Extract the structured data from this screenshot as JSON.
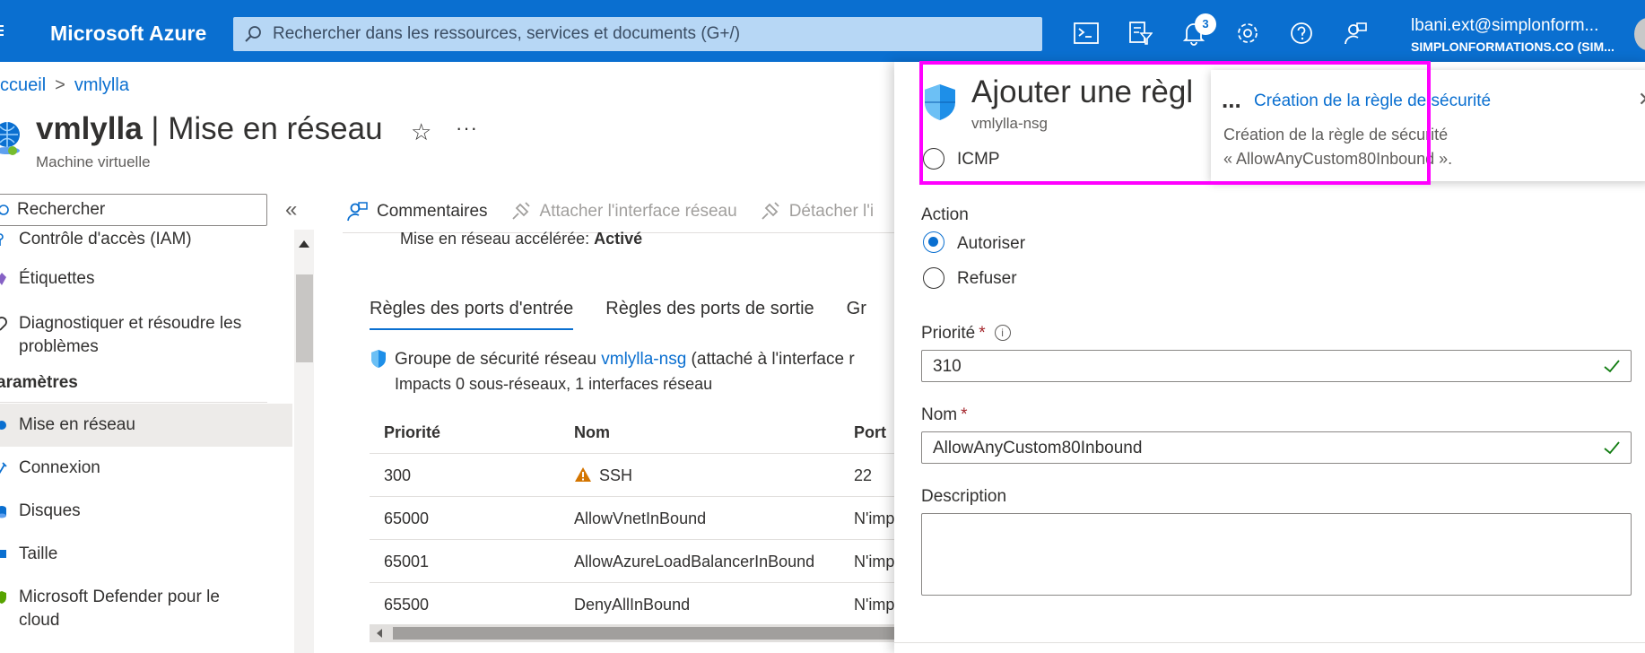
{
  "topbar": {
    "brand": "Microsoft Azure",
    "search_placeholder": "Rechercher dans les ressources, services et documents (G+/)",
    "notification_count": "3",
    "account_name": "lbani.ext@simplonform...",
    "account_org": "SIMPLONFORMATIONS.CO (SIM..."
  },
  "breadcrumb": {
    "home": "ccueil",
    "current": "vmlylla"
  },
  "page": {
    "title_resource": "vmlylla",
    "title_section": " | Mise en réseau",
    "subtitle": "Machine virtuelle"
  },
  "sidebar": {
    "search_placeholder": "Rechercher",
    "items": [
      {
        "label": "Contrôle d'accès (IAM)"
      },
      {
        "label": "Étiquettes"
      },
      {
        "label": "Diagnostiquer et résoudre les"
      },
      {
        "label": "problèmes"
      },
      {
        "label": "Mise en réseau"
      },
      {
        "label": "Connexion"
      },
      {
        "label": "Disques"
      },
      {
        "label": "Taille"
      },
      {
        "label": "Microsoft Defender pour le"
      },
      {
        "label": "cloud"
      }
    ],
    "section_label": "aramètres"
  },
  "toolbar": {
    "feedback": "Commentaires",
    "attach": "Attacher l'interface réseau",
    "detach": "Détacher l'i"
  },
  "networking": {
    "accel_label": "Mise en réseau accélérée: ",
    "accel_value": "Activé",
    "tabs": [
      "Règles des ports d'entrée",
      "Règles des ports de sortie",
      "Gr"
    ],
    "nsg_prefix": "Groupe de sécurité réseau ",
    "nsg_link": "vmlylla-nsg",
    "nsg_suffix": " (attaché à l'interface r",
    "impacts": "Impacts 0 sous-réseaux, 1 interfaces réseau",
    "columns": [
      "Priorité",
      "Nom",
      "Port"
    ],
    "rows": [
      {
        "priority": "300",
        "name": "SSH",
        "port": "22",
        "warning": true
      },
      {
        "priority": "65000",
        "name": "AllowVnetInBound",
        "port": "N'imp",
        "warning": false
      },
      {
        "priority": "65001",
        "name": "AllowAzureLoadBalancerInBound",
        "port": "N'imp",
        "warning": false
      },
      {
        "priority": "65500",
        "name": "DenyAllInBound",
        "port": "N'imp",
        "warning": false
      }
    ]
  },
  "panel": {
    "title": "Ajouter une règl",
    "subtitle": "vmlylla-nsg",
    "protocol_icmp": "ICMP",
    "action_label": "Action",
    "action_allow": "Autoriser",
    "action_deny": "Refuser",
    "priority_label": "Priorité",
    "priority_value": "310",
    "name_label": "Nom",
    "name_value": "AllowAnyCustom80Inbound",
    "description_label": "Description",
    "required_mark": "*",
    "info_glyph": "i"
  },
  "toast": {
    "dots": "...",
    "title": "Création de la règle de sécurité",
    "body_line1": "Création de la règle de sécurité",
    "body_line2": "« AllowAnyCustom80Inbound ».",
    "close": "✕"
  },
  "icons": {
    "star": "☆",
    "more": "···",
    "collapse": "«",
    "breadcrumb_sep": ">"
  },
  "colors": {
    "azure_blue": "#0a6fd0",
    "highlight": "#ff00ff",
    "success_check": "#107c10",
    "warning": "#d47500"
  }
}
